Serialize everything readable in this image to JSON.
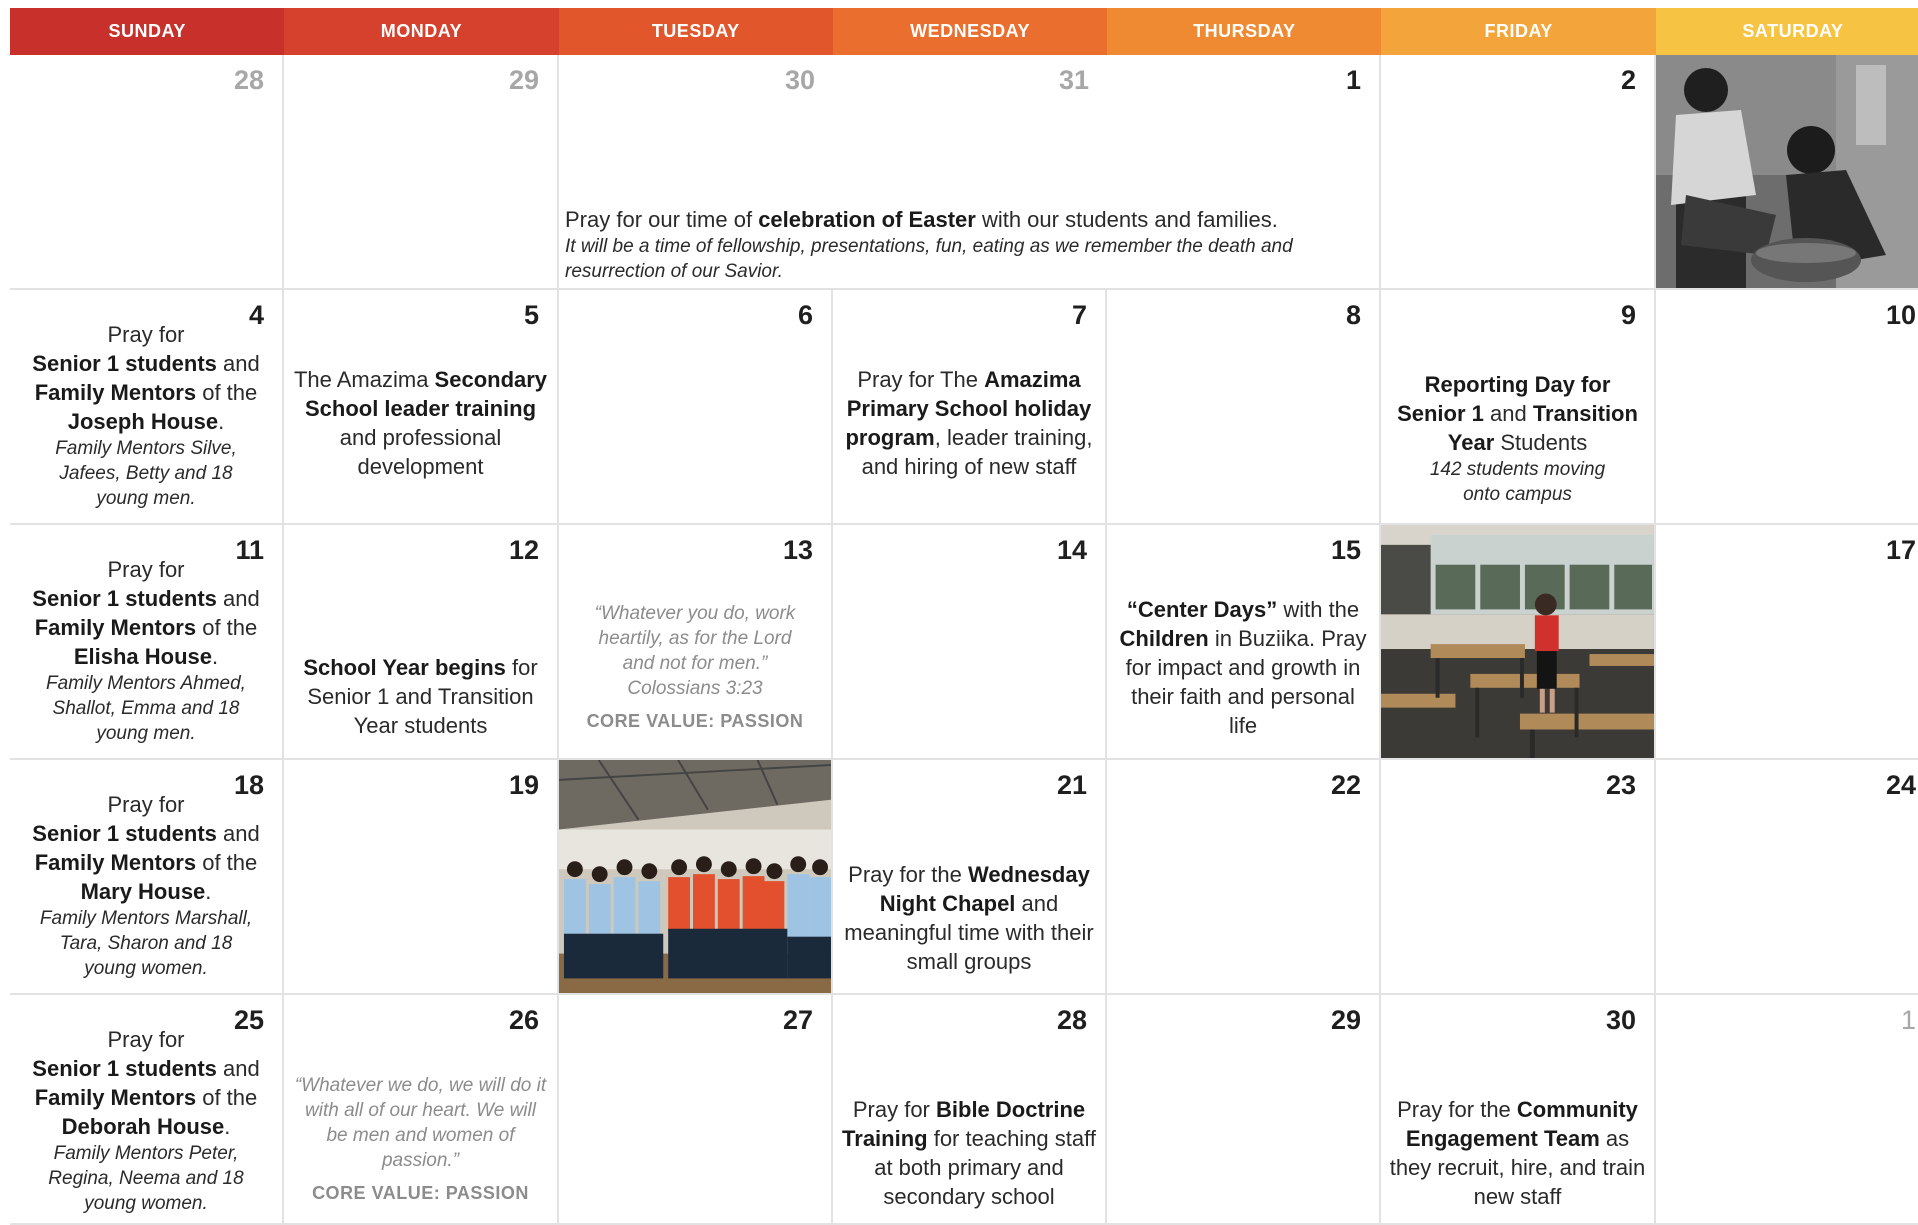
{
  "days": [
    "SUNDAY",
    "MONDAY",
    "TUESDAY",
    "WEDNESDAY",
    "THURSDAY",
    "FRIDAY",
    "SATURDAY"
  ],
  "header_colors": [
    "#c8302b",
    "#d5412c",
    "#e2562c",
    "#ea6e2e",
    "#ef8a33",
    "#f3a53c",
    "#f6c343"
  ],
  "numbers": {
    "w1": [
      "28",
      "29",
      "30",
      "31",
      "1",
      "2"
    ],
    "w2": [
      "4",
      "5",
      "6",
      "7",
      "8",
      "9",
      "10"
    ],
    "w3": [
      "11",
      "12",
      "13",
      "14",
      "15",
      "17"
    ],
    "w4": [
      "18",
      "19",
      "21",
      "22",
      "23",
      "24"
    ],
    "w5": [
      "25",
      "26",
      "27",
      "28",
      "29",
      "30",
      "1"
    ]
  },
  "easter": {
    "pre": "Pray for our time of ",
    "bold": "celebration of Easter",
    "post": " with our students and families.",
    "italic": "It will be a time of fellowship, presentations, fun, eating as we remember the death and resurrection of our Savior."
  },
  "common": {
    "pray_for": "Pray for",
    "senior1": "Senior 1 students",
    "and": " and",
    "fm": "Family Mentors",
    "of_the": " of the",
    "dot": "."
  },
  "joseph": {
    "house": "Joseph House",
    "mentors": "Family Mentors Silve, Jafees, Betty and 18 young men."
  },
  "elisha": {
    "house": "Elisha House",
    "mentors": "Family Mentors Ahmed, Shallot, Emma and 18 young men."
  },
  "mary": {
    "house": "Mary House",
    "mentors": "Family Mentors Marshall, Tara, Sharon and 18 young women."
  },
  "deborah": {
    "house": "Deborah House",
    "mentors": "Family Mentors Peter, Regina, Neema and 18 young women."
  },
  "apr5": {
    "pre": "The Amazima ",
    "bold": "Secondary School leader training",
    "post": " and professional development"
  },
  "apr7": {
    "pre": "Pray for The ",
    "bold": "Amazima Primary School holiday program",
    "post": ", leader training, and hiring of new staff"
  },
  "apr9": {
    "bold1": "Reporting Day for Senior 1",
    "mid": " and ",
    "bold2": "Transition Year",
    "post": " Students",
    "italic": "142 students moving onto campus"
  },
  "apr12": {
    "bold": "School Year begins",
    "post": " for Senior 1 and Transition Year students"
  },
  "apr13": {
    "quote": "“Whatever you do, work heartily, as for the Lord and not for men.” Colossians 3:23",
    "cv": "CORE VALUE: PASSION"
  },
  "apr15": {
    "bold1": "“Center Days”",
    "mid": " with the ",
    "bold2": "Children",
    "post": " in Buziika. Pray for impact and growth in their faith and personal life"
  },
  "apr21": {
    "pre": "Pray for the ",
    "bold": "Wednesday Night Chapel",
    "post": " and meaningful time with their small groups"
  },
  "apr26": {
    "quote": "“Whatever we do, we will do it with all of our heart. We will be men and women of passion.”",
    "cv": "CORE VALUE: PASSION"
  },
  "apr28": {
    "pre": "Pray for ",
    "bold": "Bible Doctrine Training",
    "post": " for teaching staff at both primary and secondary school"
  },
  "apr30": {
    "pre": "Pray for the ",
    "bold": "Community Engagement Team",
    "post": " as they recruit, hire, and train new staff"
  }
}
